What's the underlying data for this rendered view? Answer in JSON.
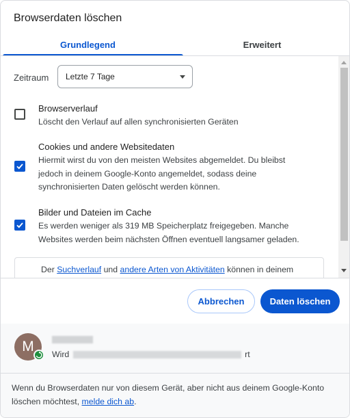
{
  "dialog": {
    "title": "Browserdaten löschen"
  },
  "tabs": [
    {
      "label": "Grundlegend",
      "active": true
    },
    {
      "label": "Erweitert",
      "active": false
    }
  ],
  "time_range": {
    "label": "Zeitraum",
    "selected": "Letzte 7 Tage"
  },
  "options": [
    {
      "title": "Browserverlauf",
      "description": "Löscht den Verlauf auf allen synchronisierten Geräten",
      "checked": false
    },
    {
      "title": "Cookies und andere Websitedaten",
      "description": "Hiermit wirst du von den meisten Websites abgemeldet. Du bleibst jedoch in deinem Google-Konto angemeldet, sodass deine synchronisierten Daten gelöscht werden können.",
      "checked": true
    },
    {
      "title": "Bilder und Dateien im Cache",
      "description": "Es werden weniger als 319 MB Speicherplatz freigegeben. Manche Websites werden beim nächsten Öffnen eventuell langsamer geladen.",
      "checked": true
    }
  ],
  "info_box": {
    "prefix": "Der ",
    "link1": "Suchverlauf",
    "middle": " und ",
    "link2": "andere Arten von Aktivitäten",
    "suffix": " können in deinem"
  },
  "buttons": {
    "cancel": "Abbrechen",
    "delete": "Daten löschen"
  },
  "account": {
    "avatar_letter": "M",
    "status_prefix": "Wird",
    "status_suffix": "rt"
  },
  "footer": {
    "text": "Wenn du Browserdaten nur von diesem Gerät, aber nicht aus deinem Google-Konto löschen möchtest, ",
    "link": "melde dich ab",
    "end": "."
  },
  "colors": {
    "accent": "#0b57d0",
    "avatar": "#8d6e63",
    "sync_badge": "#1e8e3e"
  },
  "icons": [
    "checkbox-checked-icon",
    "dropdown-arrow-icon",
    "sync-icon",
    "scroll-up-icon",
    "scroll-down-icon"
  ]
}
